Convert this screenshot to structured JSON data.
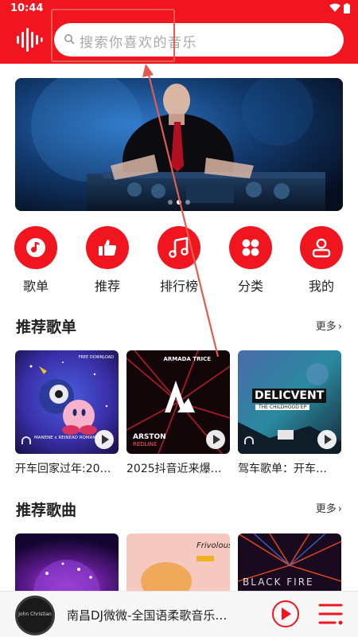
{
  "status_bar": {
    "time": "10:44"
  },
  "search": {
    "placeholder": "搜索你喜欢的音乐"
  },
  "colors": {
    "accent": "#f0151e",
    "search_highlight_outline": "#e35b50",
    "background": "#ffffff"
  },
  "banner": {
    "slide_count": 3,
    "active_index": 1
  },
  "nav": [
    {
      "label": "歌单",
      "icon": "music-note-icon"
    },
    {
      "label": "推荐",
      "icon": "thumbs-up-icon"
    },
    {
      "label": "排行榜",
      "icon": "chart-music-icon"
    },
    {
      "label": "分类",
      "icon": "category-grid-icon"
    },
    {
      "label": "我的",
      "icon": "user-icon"
    }
  ],
  "sections": {
    "playlists": {
      "title": "推荐歌单",
      "more": "更多",
      "items": [
        {
          "title": "开车回家过年:20…",
          "cover_text": "MANENE x REINEAD ROMANI ROOM",
          "cover_corner": "FREE DOWNLOAD"
        },
        {
          "title": "2025抖音近来爆…",
          "cover_text": "ARSTON",
          "cover_sub": "REDLINE",
          "cover_corner": "ARMADA TRICE"
        },
        {
          "title": "驾车歌单：开车…",
          "cover_text": "DELICVENT",
          "cover_sub": "THE CHILDHOOD EP"
        }
      ]
    },
    "songs": {
      "title": "推荐歌曲",
      "more": "更多",
      "covers": [
        {
          "cover_text": ""
        },
        {
          "cover_text": "Frivolous"
        },
        {
          "cover_text": "BLACK FIRE"
        }
      ]
    }
  },
  "player": {
    "title": "南昌DJ微微-全国语柔歌音乐…",
    "disc_label": "John Christian"
  }
}
